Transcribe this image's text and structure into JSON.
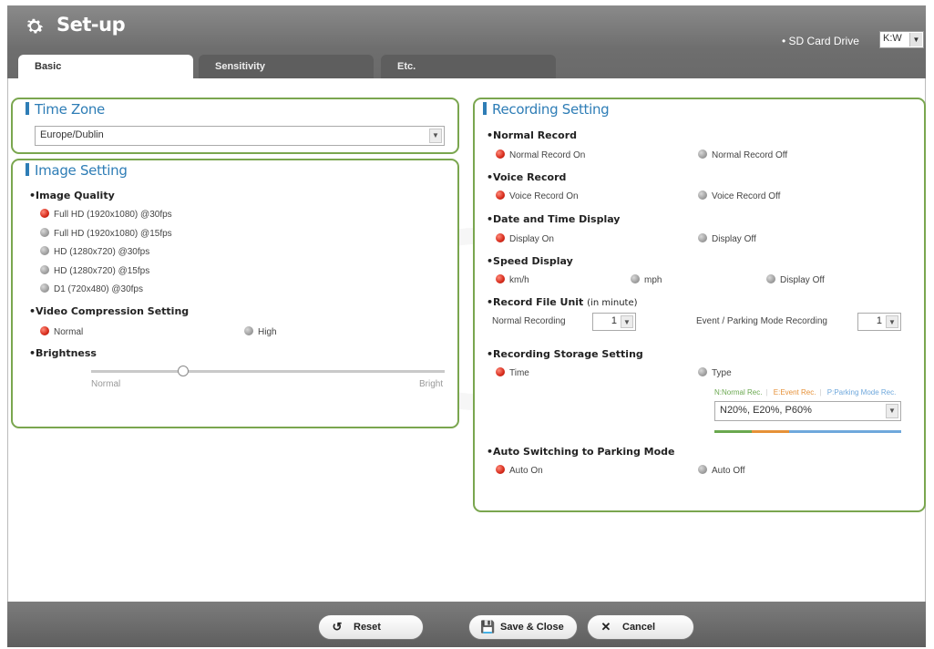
{
  "header": {
    "title": "Set-up",
    "sd_label": "• SD Card Drive",
    "sd_value": "K:W"
  },
  "tabs": [
    {
      "label": "Basic",
      "active": true
    },
    {
      "label": "Sensitivity",
      "active": false
    },
    {
      "label": "Etc.",
      "active": false
    }
  ],
  "time_zone": {
    "title": "Time Zone",
    "value": "Europe/Dublin"
  },
  "image_setting": {
    "title": "Image Setting",
    "quality_label": "Image Quality",
    "quality_options": [
      {
        "label": "Full HD (1920x1080) @30fps",
        "selected": true
      },
      {
        "label": "Full HD (1920x1080) @15fps",
        "selected": false
      },
      {
        "label": "HD (1280x720) @30fps",
        "selected": false
      },
      {
        "label": "HD (1280x720) @15fps",
        "selected": false
      },
      {
        "label": "D1 (720x480) @30fps",
        "selected": false
      }
    ],
    "compression_label": "Video Compression Setting",
    "compression_normal": "Normal",
    "compression_high": "High",
    "brightness_label": "Brightness",
    "brightness_min": "Normal",
    "brightness_max": "Bright",
    "brightness_level": 0.26
  },
  "recording": {
    "title": "Recording Setting",
    "normal_record_label": "Normal Record",
    "normal_record_on": "Normal Record On",
    "normal_record_off": "Normal Record Off",
    "voice_record_label": "Voice Record",
    "voice_record_on": "Voice Record On",
    "voice_record_off": "Voice Record Off",
    "datetime_label": "Date and Time Display",
    "datetime_on": "Display On",
    "datetime_off": "Display Off",
    "speed_label": "Speed Display",
    "speed_kmh": "km/h",
    "speed_mph": "mph",
    "speed_off": "Display Off",
    "file_unit_label": "Record File Unit",
    "file_unit_suffix": "(in minute)",
    "normal_recording_label": "Normal Recording",
    "normal_recording_value": "1",
    "event_parking_label": "Event / Parking Mode Recording",
    "event_parking_value": "1",
    "storage_label": "Recording Storage Setting",
    "storage_time": "Time",
    "storage_type": "Type",
    "legend_n": "N:Normal Rec.",
    "legend_e": "E:Event Rec.",
    "legend_p": "P:Parking Mode Rec.",
    "storage_value": "N20%, E20%, P60%",
    "storage_colors": {
      "normal": "#6aa84f",
      "event": "#e69138",
      "parking": "#6fa8dc"
    },
    "auto_switch_label": "Auto Switching to Parking Mode",
    "auto_on": "Auto On",
    "auto_off": "Auto Off"
  },
  "footer": {
    "reset": "Reset",
    "save_close": "Save & Close",
    "cancel": "Cancel"
  }
}
